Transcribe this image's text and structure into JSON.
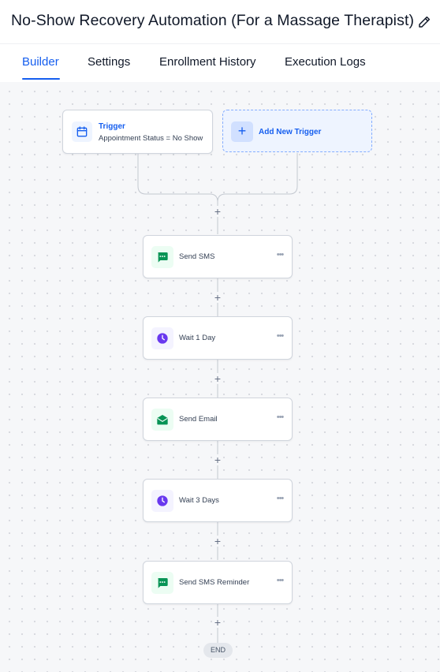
{
  "header": {
    "title": "No-Show Recovery Automation (For a Massage Therapist)"
  },
  "tabs": [
    {
      "label": "Builder"
    },
    {
      "label": "Settings"
    },
    {
      "label": "Enrollment History"
    },
    {
      "label": "Execution Logs"
    }
  ],
  "trigger": {
    "title": "Trigger",
    "subtitle": "Appointment Status = No Show"
  },
  "add_trigger": {
    "label": "Add New Trigger"
  },
  "steps": [
    {
      "label": "Send SMS",
      "icon": "sms-icon"
    },
    {
      "label": "Wait 1 Day",
      "icon": "clock-icon"
    },
    {
      "label": "Send Email",
      "icon": "email-icon"
    },
    {
      "label": "Wait 3 Days",
      "icon": "clock-icon"
    },
    {
      "label": "Send SMS Reminder",
      "icon": "sms-icon"
    }
  ],
  "end": {
    "label": "END"
  },
  "colors": {
    "accent": "#155eef",
    "sms_green": "#079455",
    "wait_purple": "#7a5af8"
  }
}
